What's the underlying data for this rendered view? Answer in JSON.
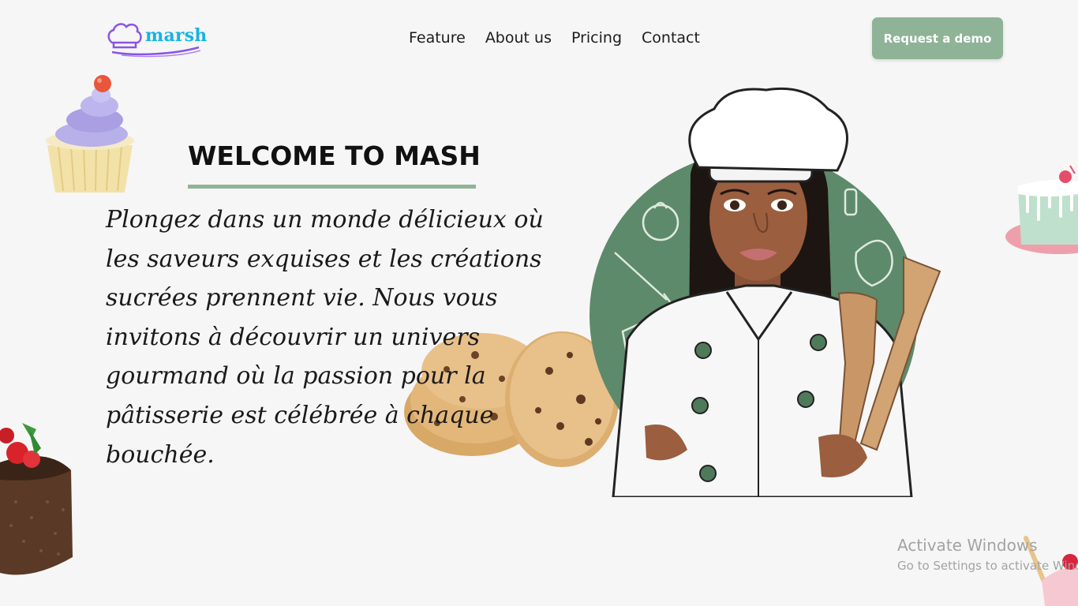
{
  "header": {
    "logo_text": "marsh",
    "nav": [
      "Feature",
      "About us",
      "Pricing",
      "Contact"
    ],
    "cta_label": "Request a demo"
  },
  "hero": {
    "title": "WELCOME TO MASH",
    "intro": "Plongez dans un monde délicieux où les saveurs exquises et les créations sucrées prennent vie. Nous vous invitons à découvrir un univers gourmand où la passion pour la pâtisserie est célébrée à chaque bouchée."
  },
  "watermark": {
    "title": "Activate Windows",
    "subtitle": "Go to Settings to activate Windows."
  },
  "colors": {
    "accent_green": "#8fb396",
    "logo_blue": "#16b3e6",
    "logo_purple": "#8a54e8",
    "chef_backdrop": "#5d8a6a"
  },
  "icons": [
    "chef-hat-logo-icon",
    "cupcake-illustration",
    "cake-illustration",
    "cookies-illustration",
    "chef-illustration"
  ]
}
